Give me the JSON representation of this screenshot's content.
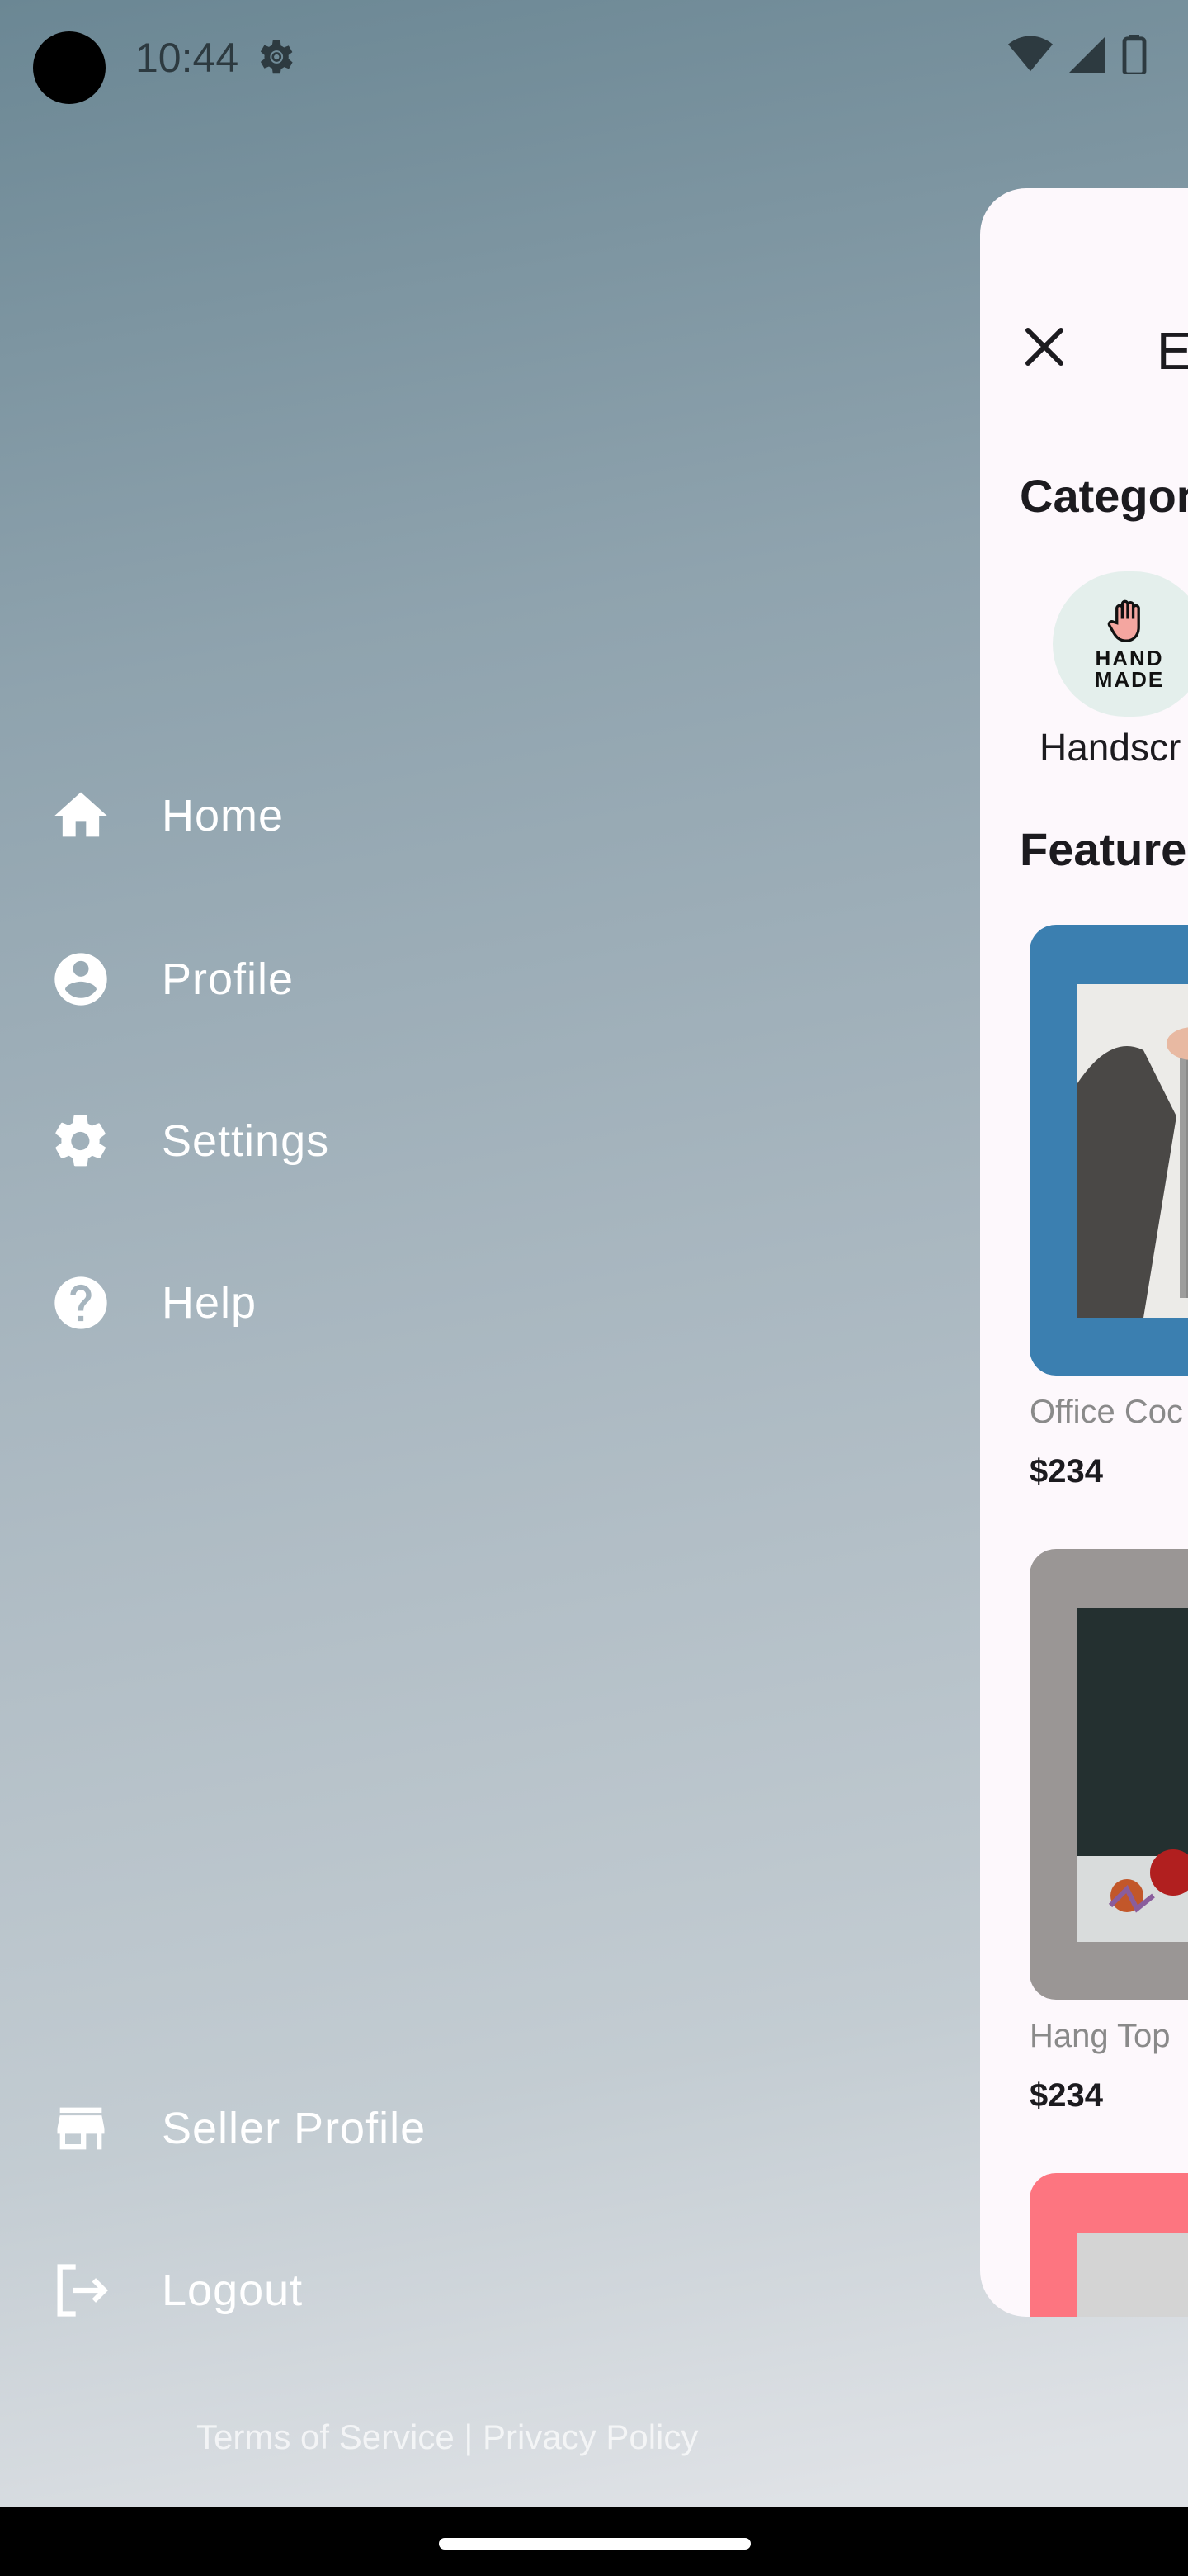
{
  "status_bar": {
    "time": "10:44"
  },
  "drawer": {
    "items": [
      {
        "label": "Home",
        "icon": "home-icon"
      },
      {
        "label": "Profile",
        "icon": "account-circle-icon"
      },
      {
        "label": "Settings",
        "icon": "settings-icon"
      },
      {
        "label": "Help",
        "icon": "help-icon"
      }
    ],
    "bottom_items": [
      {
        "label": "Seller Profile",
        "icon": "store-icon"
      },
      {
        "label": "Logout",
        "icon": "logout-icon"
      }
    ],
    "footer": "Terms of Service | Privacy Policy"
  },
  "main": {
    "app_bar_title": "E",
    "categories_title": "Categor",
    "category": {
      "label": "Handscr",
      "badge_line1": "HAND",
      "badge_line2": "MADE"
    },
    "featured_title": "Feature",
    "products": [
      {
        "name": "Office Coc",
        "price": "$234",
        "card_color": "#3b7fb0"
      },
      {
        "name": "Hang Top",
        "price": "$234",
        "card_color": "#9a9695"
      },
      {
        "name": "",
        "price": "",
        "card_color": "#fd7580"
      }
    ]
  },
  "colors": {
    "drawer_text": "#ffffff",
    "card_background": "#fdf8fc",
    "category_chip": "#e4efec"
  }
}
